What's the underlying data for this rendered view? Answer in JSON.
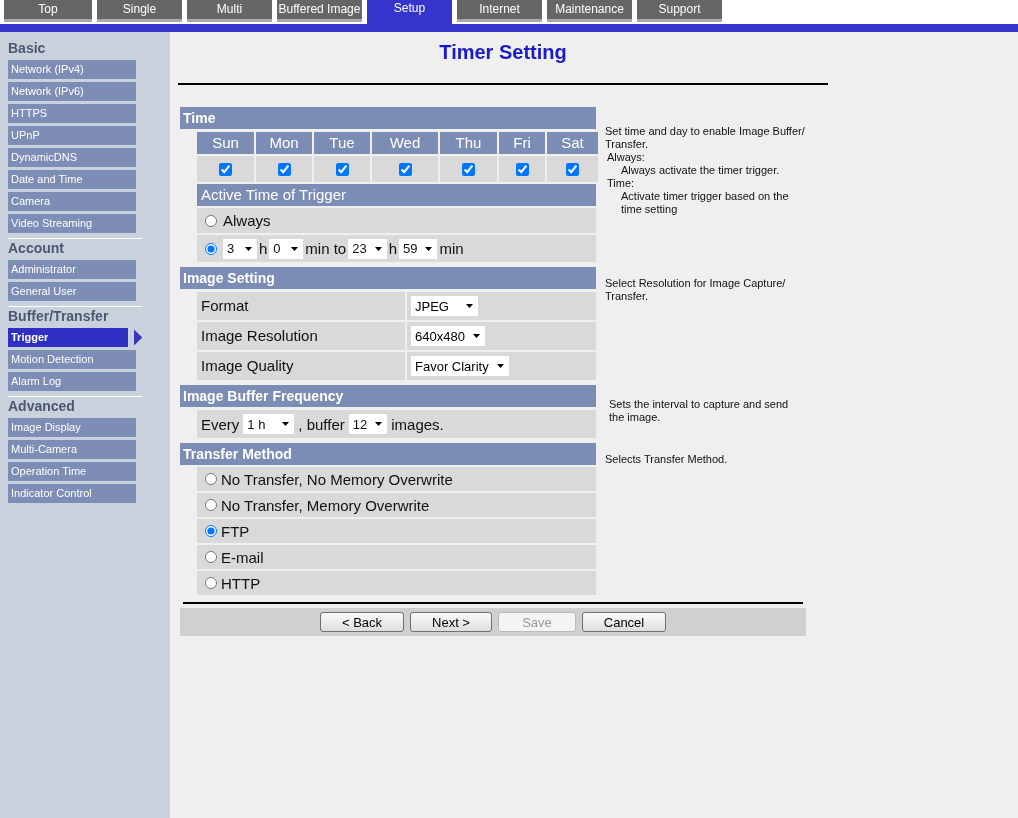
{
  "tabs": [
    {
      "label": "Top",
      "selected": false
    },
    {
      "label": "Single",
      "selected": false
    },
    {
      "label": "Multi",
      "selected": false
    },
    {
      "label": "Buffered Image",
      "selected": false
    },
    {
      "label": "Setup",
      "selected": true
    },
    {
      "label": "Internet",
      "selected": false
    },
    {
      "label": "Maintenance",
      "selected": false
    },
    {
      "label": "Support",
      "selected": false
    }
  ],
  "sidebar": [
    {
      "heading": "Basic",
      "items": [
        {
          "label": "Network (IPv4)",
          "selected": false
        },
        {
          "label": "Network (IPv6)",
          "selected": false
        },
        {
          "label": "HTTPS",
          "selected": false
        },
        {
          "label": "UPnP",
          "selected": false
        },
        {
          "label": "DynamicDNS",
          "selected": false
        },
        {
          "label": "Date and Time",
          "selected": false
        },
        {
          "label": "Camera",
          "selected": false
        },
        {
          "label": "Video Streaming",
          "selected": false
        }
      ]
    },
    {
      "heading": "Account",
      "items": [
        {
          "label": "Administrator",
          "selected": false
        },
        {
          "label": "General User",
          "selected": false
        }
      ]
    },
    {
      "heading": "Buffer/Transfer",
      "items": [
        {
          "label": "Trigger",
          "selected": true
        },
        {
          "label": "Motion Detection",
          "selected": false
        },
        {
          "label": "Alarm Log",
          "selected": false
        }
      ]
    },
    {
      "heading": "Advanced",
      "items": [
        {
          "label": "Image Display",
          "selected": false
        },
        {
          "label": "Multi-Camera",
          "selected": false
        },
        {
          "label": "Operation Time",
          "selected": false
        },
        {
          "label": "Indicator Control",
          "selected": false
        }
      ]
    }
  ],
  "title": "Timer Setting",
  "sections": [
    {
      "kind": "time",
      "heading": "Time",
      "help": [
        {
          "kind": "text",
          "text": "Set time and day to enable Image Buffer/ Transfer."
        },
        {
          "kind": "term",
          "text": "Always:"
        },
        {
          "kind": "desc",
          "text": "Always activate the timer trigger."
        },
        {
          "kind": "term",
          "text": "Time:"
        },
        {
          "kind": "desc",
          "text": "Activate timer trigger based on the time setting"
        }
      ],
      "days": [
        {
          "label": "Sun",
          "checked": true
        },
        {
          "label": "Mon",
          "checked": true
        },
        {
          "label": "Tue",
          "checked": true
        },
        {
          "label": "Wed",
          "checked": true
        },
        {
          "label": "Thu",
          "checked": true
        },
        {
          "label": "Fri",
          "checked": true
        },
        {
          "label": "Sat",
          "checked": true
        }
      ],
      "subheading": "Active Time of Trigger",
      "options": [
        {
          "selected": false,
          "parts": [
            {
              "kind": "text",
              "text": "Always"
            }
          ]
        },
        {
          "selected": true,
          "parts": [
            {
              "kind": "select",
              "value": "3"
            },
            {
              "kind": "text",
              "text": "h"
            },
            {
              "kind": "select",
              "value": "0"
            },
            {
              "kind": "text",
              "text": "min to"
            },
            {
              "kind": "select",
              "value": "23"
            },
            {
              "kind": "text",
              "text": "h"
            },
            {
              "kind": "select",
              "value": "59"
            },
            {
              "kind": "text",
              "text": "min"
            }
          ]
        }
      ]
    },
    {
      "kind": "settings",
      "heading": "Image Setting",
      "help": [
        {
          "kind": "text",
          "text": "Select Resolution for Image Capture/ Transfer."
        }
      ],
      "rows": [
        {
          "label": "Format",
          "value": "JPEG"
        },
        {
          "label": "Image Resolution",
          "value": "640x480"
        },
        {
          "label": "Image Quality",
          "value": "Favor Clarity"
        }
      ]
    },
    {
      "kind": "inline",
      "heading": "Image Buffer Frequency",
      "help": [
        {
          "kind": "text",
          "text": "Sets the interval to capture and send the image."
        }
      ],
      "parts": [
        {
          "kind": "text",
          "text": "Every"
        },
        {
          "kind": "select",
          "value": "1 h"
        },
        {
          "kind": "text",
          "text": ", buffer"
        },
        {
          "kind": "select",
          "value": "12"
        },
        {
          "kind": "text",
          "text": "images."
        }
      ]
    },
    {
      "kind": "radios",
      "heading": "Transfer Method",
      "help": [
        {
          "kind": "text",
          "text": "Selects Transfer Method."
        }
      ],
      "options": [
        {
          "label": "No Transfer, No Memory Overwrite",
          "selected": false
        },
        {
          "label": "No Transfer, Memory Overwrite",
          "selected": false
        },
        {
          "label": "FTP",
          "selected": true
        },
        {
          "label": "E-mail",
          "selected": false
        },
        {
          "label": "HTTP",
          "selected": false
        }
      ]
    }
  ],
  "buttons": [
    {
      "label": "< Back",
      "disabled": false
    },
    {
      "label": "Next >",
      "disabled": false
    },
    {
      "label": "Save",
      "disabled": true
    },
    {
      "label": "Cancel",
      "disabled": false
    }
  ]
}
